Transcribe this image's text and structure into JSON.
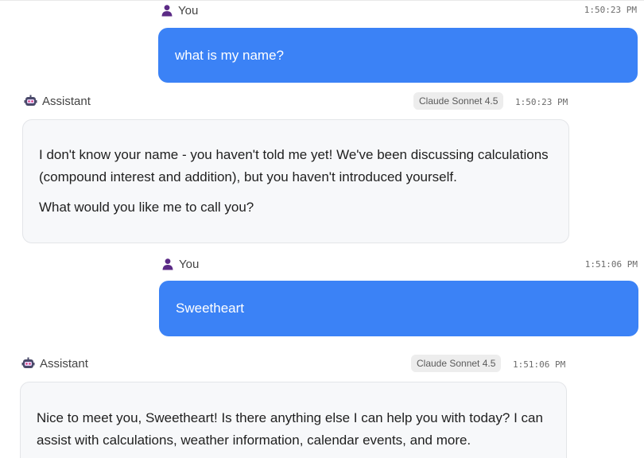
{
  "messages": [
    {
      "role": "user",
      "sender": "You",
      "timestamp": "1:50:23 PM",
      "text": "what is my name?"
    },
    {
      "role": "assistant",
      "sender": "Assistant",
      "model": "Claude Sonnet 4.5",
      "timestamp": "1:50:23 PM",
      "paragraphs": [
        "I don't know your name - you haven't told me yet! We've been discussing calculations (compound interest and addition), but you haven't introduced yourself.",
        "What would you like me to call you?"
      ]
    },
    {
      "role": "user",
      "sender": "You",
      "timestamp": "1:51:06 PM",
      "text": "Sweetheart"
    },
    {
      "role": "assistant",
      "sender": "Assistant",
      "model": "Claude Sonnet 4.5",
      "timestamp": "1:51:06 PM",
      "paragraphs": [
        "Nice to meet you, Sweetheart! Is there anything else I can help you with today? I can assist with calculations, weather information, calendar events, and more."
      ]
    }
  ],
  "colors": {
    "user_bubble": "#3b82f6",
    "assistant_bubble": "#f7f8fa",
    "person_icon": "#5b2a86",
    "badge_bg": "#ededed"
  },
  "icons": {
    "user": "person-icon",
    "assistant": "robot-icon"
  }
}
